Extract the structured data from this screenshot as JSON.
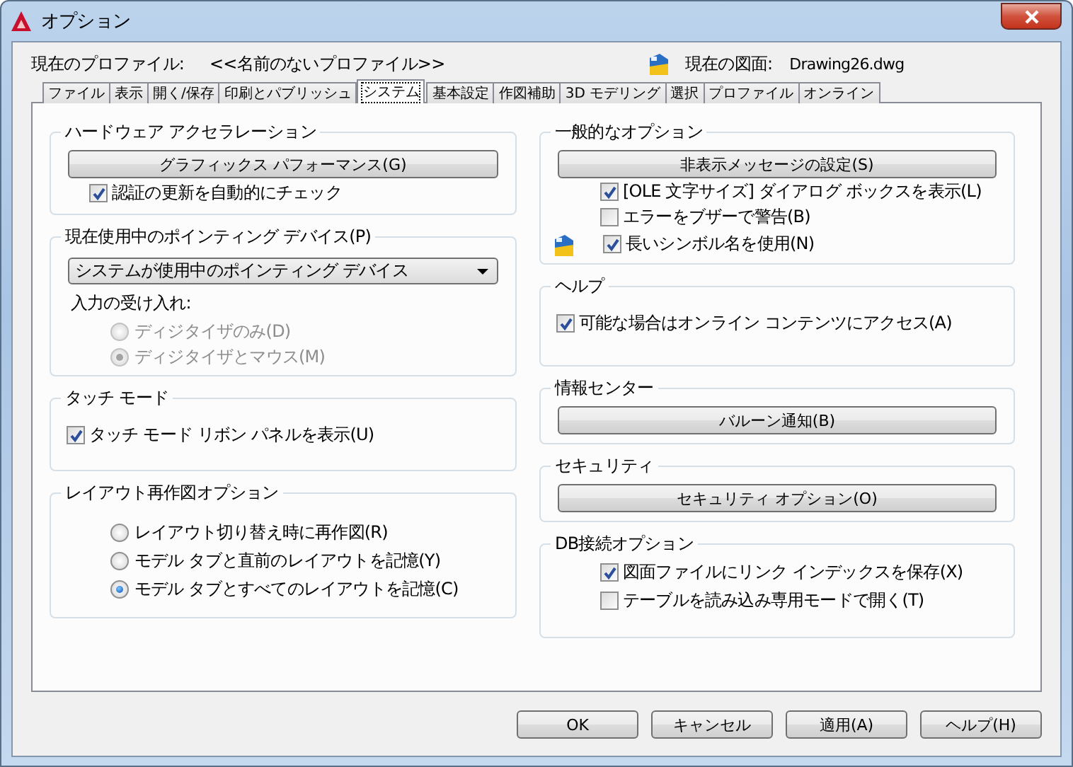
{
  "window": {
    "title": "オプション"
  },
  "profile": {
    "label": "現在のプロファイル:",
    "value": "<<名前のないプロファイル>>",
    "drawing_label": "現在の図面:",
    "drawing_value": "Drawing26.dwg"
  },
  "tabs": [
    {
      "label": "ファイル",
      "selected": false
    },
    {
      "label": "表示",
      "selected": false
    },
    {
      "label": "開く/保存",
      "selected": false
    },
    {
      "label": "印刷とパブリッシュ",
      "selected": false
    },
    {
      "label": "システム",
      "selected": true
    },
    {
      "label": "基本設定",
      "selected": false
    },
    {
      "label": "作図補助",
      "selected": false
    },
    {
      "label": "3D モデリング",
      "selected": false
    },
    {
      "label": "選択",
      "selected": false
    },
    {
      "label": "プロファイル",
      "selected": false
    },
    {
      "label": "オンライン",
      "selected": false
    }
  ],
  "left_groups": [
    {
      "title": "ハードウェア アクセラレーション",
      "items": [
        {
          "kind": "button",
          "label": "グラフィックス パフォーマンス(G)"
        },
        {
          "kind": "check",
          "label": "認証の更新を自動的にチェック",
          "checked": true,
          "disabled": false,
          "has_icon": false
        }
      ]
    },
    {
      "title": "現在使用中のポインティング デバイス(P)",
      "items": [
        {
          "kind": "dropdown",
          "value": "システムが使用中のポインティング デバイス"
        },
        {
          "kind": "label",
          "label": "入力の受け入れ:"
        },
        {
          "kind": "radio",
          "label": "ディジタイザのみ(D)",
          "selected": false,
          "disabled": true
        },
        {
          "kind": "radio",
          "label": "ディジタイザとマウス(M)",
          "selected": true,
          "disabled": true
        }
      ]
    },
    {
      "title": "タッチ モード",
      "items": [
        {
          "kind": "check",
          "label": "タッチ モード リボン パネルを表示(U)",
          "checked": true,
          "disabled": false,
          "has_icon": false
        }
      ]
    },
    {
      "title": "レイアウト再作図オプション",
      "items": [
        {
          "kind": "radio",
          "label": "レイアウト切り替え時に再作図(R)",
          "selected": false,
          "disabled": false
        },
        {
          "kind": "radio",
          "label": "モデル タブと直前のレイアウトを記憶(Y)",
          "selected": false,
          "disabled": false
        },
        {
          "kind": "radio",
          "label": "モデル タブとすべてのレイアウトを記憶(C)",
          "selected": true,
          "disabled": false
        }
      ]
    }
  ],
  "right_groups": [
    {
      "title": "一般的なオプション",
      "items": [
        {
          "kind": "button",
          "label": "非表示メッセージの設定(S)"
        },
        {
          "kind": "check",
          "label": "[OLE 文字サイズ] ダイアログ ボックスを表示(L)",
          "checked": true,
          "disabled": false,
          "has_icon": false
        },
        {
          "kind": "check",
          "label": "エラーをブザーで警告(B)",
          "checked": false,
          "disabled": false,
          "has_icon": false
        },
        {
          "kind": "check",
          "label": "長いシンボル名を使用(N)",
          "checked": true,
          "disabled": false,
          "has_icon": true
        }
      ]
    },
    {
      "title": "ヘルプ",
      "items": [
        {
          "kind": "check",
          "label": "可能な場合はオンライン コンテンツにアクセス(A)",
          "checked": true,
          "disabled": false,
          "has_icon": false
        }
      ]
    },
    {
      "title": "情報センター",
      "items": [
        {
          "kind": "button",
          "label": "バルーン通知(B)"
        }
      ]
    },
    {
      "title": "セキュリティ",
      "items": [
        {
          "kind": "button",
          "label": "セキュリティ オプション(O)"
        }
      ]
    },
    {
      "title": "DB接続オプション",
      "items": [
        {
          "kind": "check",
          "label": "図面ファイルにリンク インデックスを保存(X)",
          "checked": true,
          "disabled": false,
          "has_icon": false
        },
        {
          "kind": "check",
          "label": "テーブルを読み込み専用モードで開く(T)",
          "checked": false,
          "disabled": false,
          "has_icon": false
        }
      ]
    }
  ],
  "buttons": [
    "OK",
    "キャンセル",
    "適用(A)",
    "ヘルプ(H)"
  ]
}
